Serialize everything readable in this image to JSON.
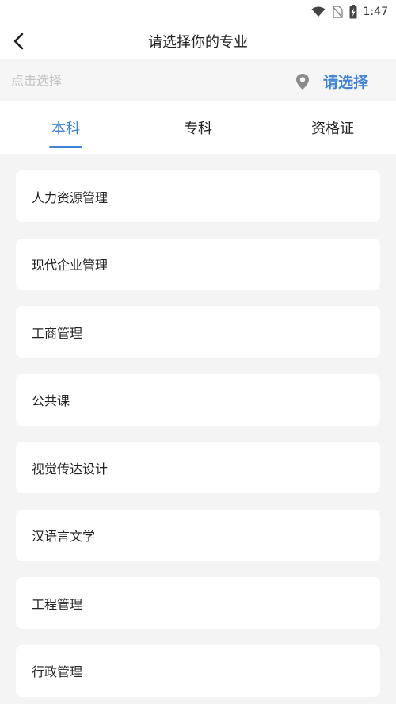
{
  "status_bar": {
    "time": "1:47",
    "icons": [
      "wifi-icon",
      "no-signal-icon",
      "battery-charging-icon"
    ]
  },
  "header": {
    "title": "请选择你的专业",
    "back_icon": "chevron-left-icon"
  },
  "search": {
    "placeholder": "点击选择",
    "value": "",
    "location_icon": "location-pin-icon",
    "select_label": "请选择"
  },
  "tabs": [
    {
      "label": "本科",
      "active": true
    },
    {
      "label": "专科",
      "active": false
    },
    {
      "label": "资格证",
      "active": false
    }
  ],
  "majors": [
    {
      "label": "人力资源管理"
    },
    {
      "label": "现代企业管理"
    },
    {
      "label": "工商管理"
    },
    {
      "label": "公共课"
    },
    {
      "label": "视觉传达设计"
    },
    {
      "label": "汉语言文学"
    },
    {
      "label": "工程管理"
    },
    {
      "label": "行政管理"
    }
  ],
  "colors": {
    "accent": "#3f82d8",
    "background": "#f4f4f5",
    "placeholder": "#c4c4c4"
  }
}
